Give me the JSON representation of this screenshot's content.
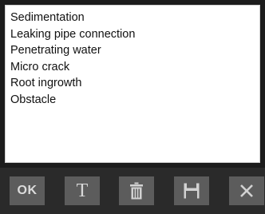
{
  "list": {
    "items": [
      {
        "label": "Sedimentation"
      },
      {
        "label": "Leaking pipe connection"
      },
      {
        "label": "Penetrating water"
      },
      {
        "label": "Micro crack"
      },
      {
        "label": "Root ingrowth"
      },
      {
        "label": "Obstacle"
      }
    ]
  },
  "toolbar": {
    "ok_label": "OK",
    "text_label": "T",
    "delete_icon": "trash-icon",
    "save_icon": "floppy-disk-icon",
    "close_icon": "close-icon"
  },
  "colors": {
    "background": "#1c1c1c",
    "button": "#5c5c5c",
    "button_text": "#d2d2d2",
    "list_background": "#ffffff"
  }
}
